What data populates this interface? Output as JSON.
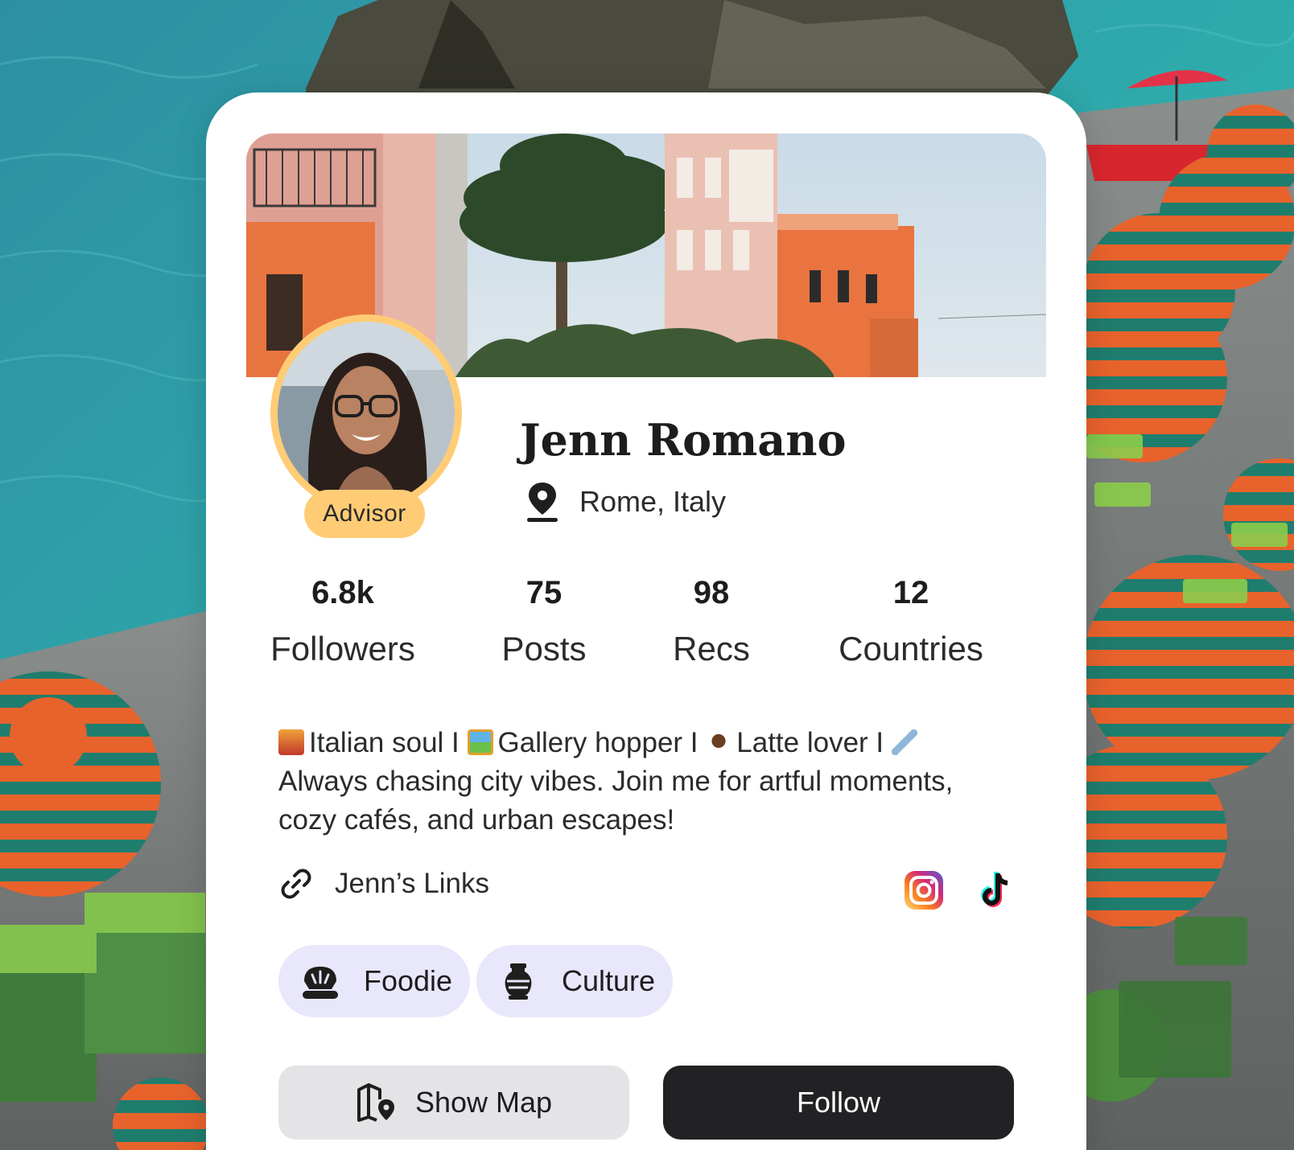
{
  "profile": {
    "name": "Jenn Romano",
    "location": "Rome, Italy",
    "badge": "Advisor"
  },
  "stats": [
    {
      "value": "6.8k",
      "label": "Followers"
    },
    {
      "value": "75",
      "label": "Posts"
    },
    {
      "value": "98",
      "label": "Recs"
    },
    {
      "value": "12",
      "label": "Countries"
    }
  ],
  "bio": {
    "line1_parts": [
      "Italian soul I",
      "Gallery hopper I",
      "Latte lover I"
    ],
    "line2": "Always chasing city vibes. Join me for artful moments,",
    "line3": "cozy cafés, and urban escapes!",
    "emoji_icons": [
      "cityscape-emoji",
      "framed-picture-emoji",
      "coffee-emoji",
      "airplane-emoji"
    ]
  },
  "links": {
    "label": "Jenn’s Links",
    "social_icons": [
      "instagram-icon",
      "tiktok-icon"
    ]
  },
  "tags": [
    {
      "label": "Foodie",
      "icon": "bread-icon"
    },
    {
      "label": "Culture",
      "icon": "vase-icon"
    }
  ],
  "actions": {
    "show_map": "Show Map",
    "follow": "Follow"
  },
  "colors": {
    "badge": "#ffcc75",
    "tag_bg": "#e8e7fb",
    "follow_bg": "#222224",
    "map_btn_bg": "#e4e4e7"
  }
}
